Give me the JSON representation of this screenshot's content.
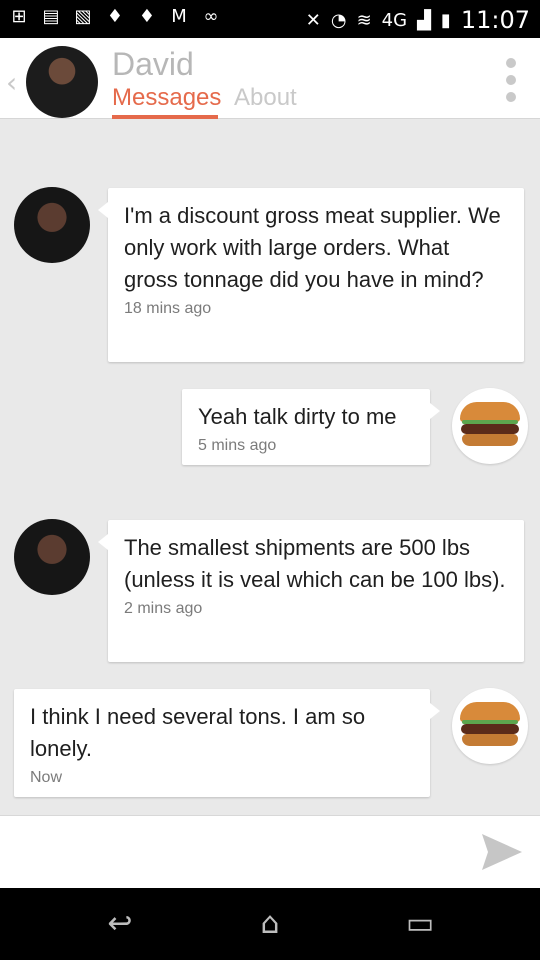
{
  "status_bar": {
    "icons_left": [
      "plus-icon",
      "calendar-icon",
      "image-icon",
      "flame-icon",
      "flame-icon",
      "gmail-icon",
      "voicemail-icon"
    ],
    "icons_right": [
      "mute-icon",
      "alarm-icon",
      "wifi-icon",
      "4g-icon",
      "signal-icon",
      "battery-icon"
    ],
    "network": "4G",
    "time": "11:07"
  },
  "header": {
    "name": "David",
    "tabs": [
      {
        "label": "Messages",
        "active": true
      },
      {
        "label": "About",
        "active": false
      }
    ],
    "accent_color": "#e56a4b"
  },
  "messages": [
    {
      "side": "incoming",
      "text": "I'm a discount gross meat supplier. We only work with large orders. What gross tonnage did you have in mind?",
      "time": "18 mins ago"
    },
    {
      "side": "outgoing",
      "text": "Yeah talk dirty to me",
      "time": "5 mins ago"
    },
    {
      "side": "incoming",
      "text": "The smallest shipments are 500 lbs (unless it is veal which can be 100 lbs).",
      "time": "2 mins ago"
    },
    {
      "side": "outgoing",
      "text": "I think I need several tons. I am so lonely.",
      "time": "Now"
    }
  ],
  "composer": {
    "placeholder": "",
    "send_icon": "send-icon"
  },
  "navbar": {
    "buttons": [
      "back-icon",
      "home-icon",
      "recents-icon"
    ]
  }
}
